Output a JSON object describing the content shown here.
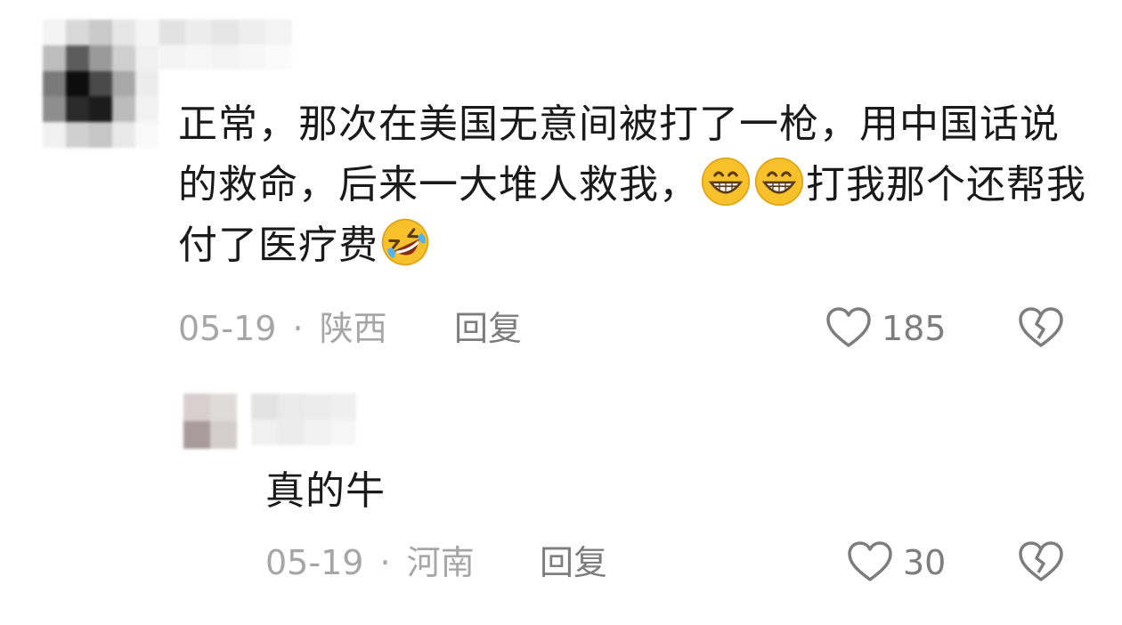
{
  "comment": {
    "text_part1": "正常，那次在美国无意间被打了一枪，用中国话说的救命，后来一大堆人救我，",
    "emoji_1": "grinning-face-icon",
    "emoji_2": "grinning-face-icon",
    "text_part2": "打我那个还帮我付了医疗费",
    "emoji_3": "rolling-on-floor-laughing-icon",
    "date": "05-19",
    "separator": "·",
    "location": "陕西",
    "reply_label": "回复",
    "like_count": "185"
  },
  "reply": {
    "text": "真的牛",
    "date": "05-19",
    "separator": "·",
    "location": "河南",
    "reply_label": "回复",
    "like_count": "30"
  },
  "colors": {
    "text": "#1a1a1a",
    "meta": "#a6a6a6",
    "action": "#7d7d7d",
    "emoji_face": "#f7c12b"
  }
}
